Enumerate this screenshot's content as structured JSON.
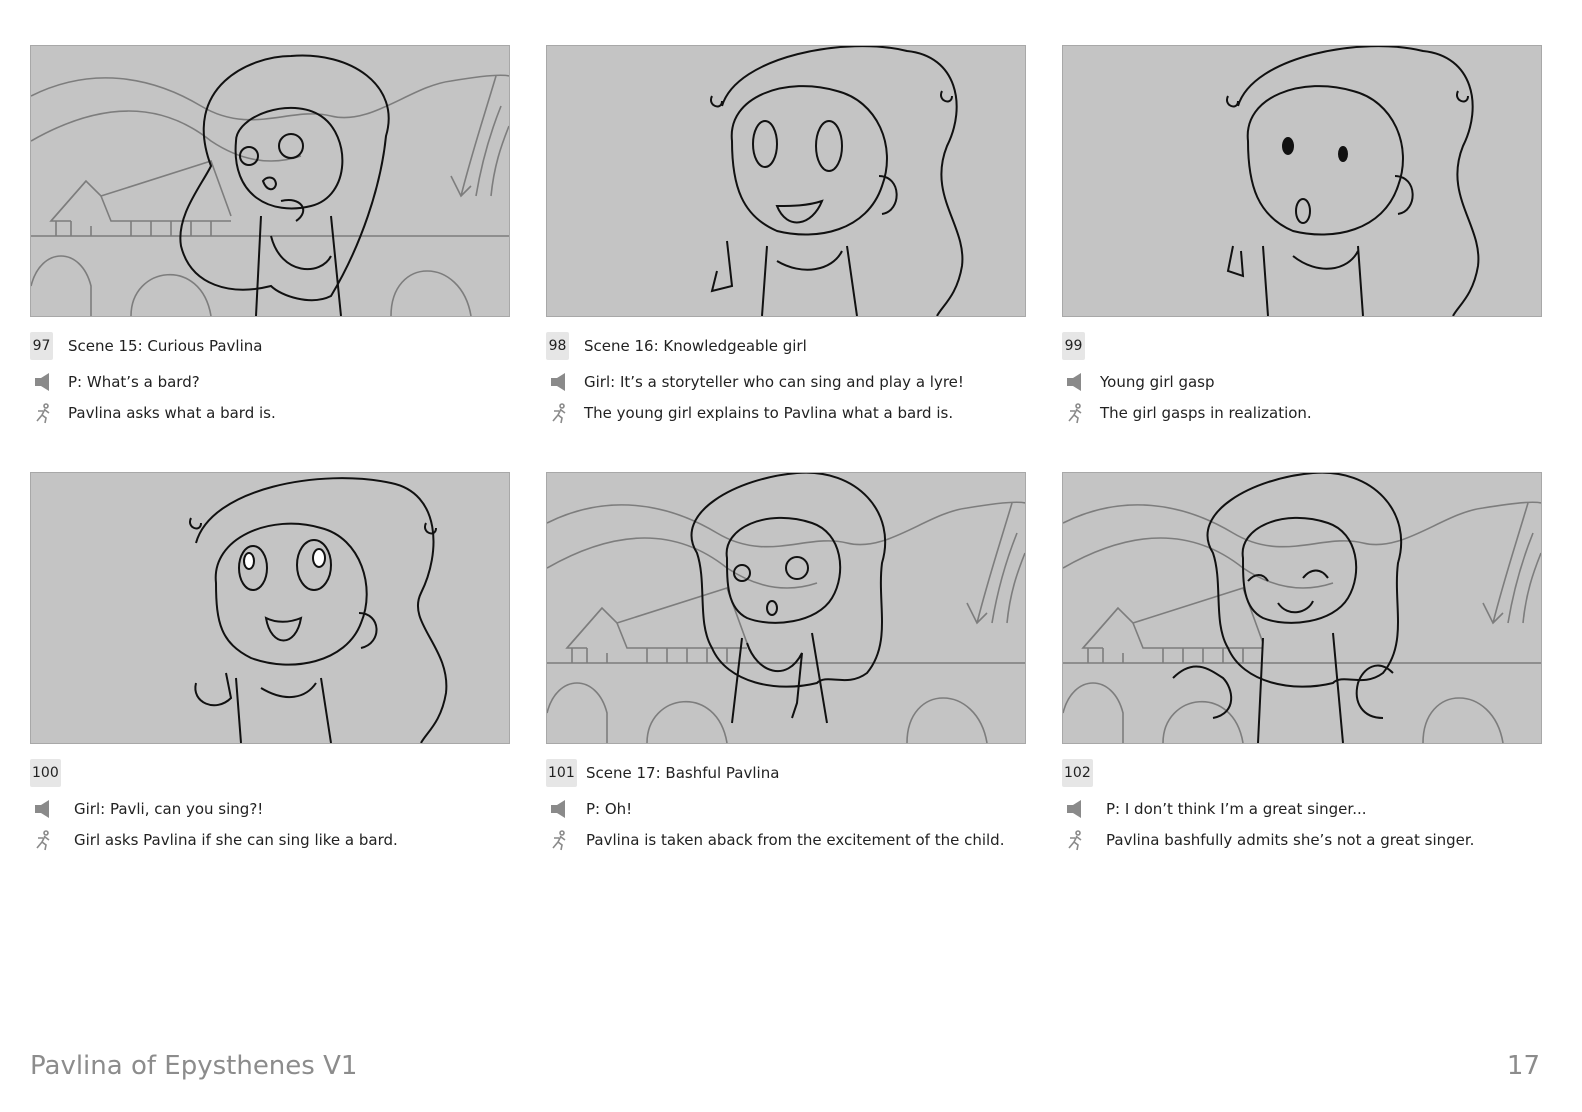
{
  "panels": [
    {
      "number": "97",
      "scene": "Scene 15: Curious Pavlina",
      "dialogue": "P: What’s a bard?",
      "action": "Pavlina asks what a bard is."
    },
    {
      "number": "98",
      "scene": "Scene 16: Knowledgeable girl",
      "dialogue": "Girl: It’s a storyteller who can sing and play a lyre!",
      "action": "The young girl explains to Pavlina what a bard is."
    },
    {
      "number": "99",
      "scene": "",
      "dialogue": "Young girl gasp",
      "action": "The girl gasps in realization."
    },
    {
      "number": "100",
      "scene": "",
      "dialogue": "Girl: Pavli, can you sing?!",
      "action": "Girl asks Pavlina if she can sing like a bard."
    },
    {
      "number": "101",
      "scene": "Scene 17: Bashful Pavlina",
      "dialogue": "P: Oh!",
      "action": "Pavlina is taken aback from the excitement of the child."
    },
    {
      "number": "102",
      "scene": "",
      "dialogue": "P: I don’t think I’m a great singer...",
      "action": "Pavlina bashfully admits she’s not a great singer."
    }
  ],
  "footer": {
    "title": "Pavlina of Epysthenes V1",
    "page": "17"
  },
  "icons": {
    "dialogue": "speaker-icon",
    "action": "running-figure-icon"
  },
  "colors": {
    "frame_bg": "#c4c4c4",
    "number_badge_bg": "#e6e6e6",
    "footer_text": "#8c8c8c",
    "icon": "#8a8a8a"
  }
}
